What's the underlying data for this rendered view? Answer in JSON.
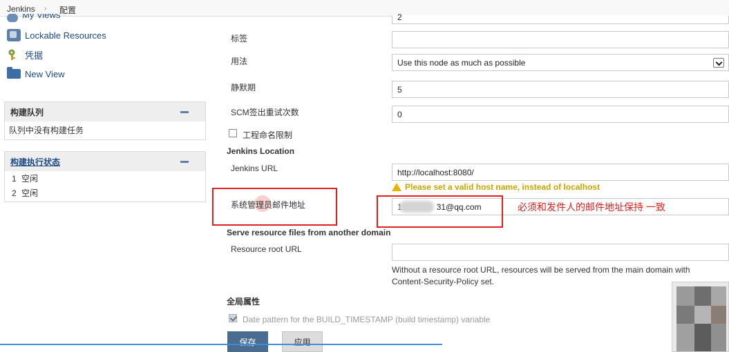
{
  "breadcrumb": {
    "items": [
      "Jenkins",
      "配置"
    ],
    "separator": "›"
  },
  "sidebar": {
    "links": [
      {
        "label": "My Views",
        "icon": "my-views-icon"
      },
      {
        "label": "Lockable Resources",
        "icon": "lock-icon"
      },
      {
        "label": "凭据",
        "icon": "key-icon"
      },
      {
        "label": "New View",
        "icon": "folder-icon"
      }
    ],
    "queue": {
      "title": "构建队列",
      "empty_text": "队列中没有构建任务"
    },
    "executors": {
      "title": "构建执行状态",
      "rows": [
        {
          "num": "1",
          "status": "空闲"
        },
        {
          "num": "2",
          "status": "空闲"
        }
      ]
    }
  },
  "form": {
    "executors_value": "2",
    "labels_label": "标签",
    "labels_value": "",
    "usage_label": "用法",
    "usage_value": "Use this node as much as possible",
    "quiet_label": "静默期",
    "quiet_value": "5",
    "scm_label": "SCM签出重试次数",
    "scm_value": "0",
    "restrict_label": "工程命名限制",
    "restrict_checked": false,
    "location_section": "Jenkins Location",
    "url_label": "Jenkins URL",
    "url_value": "http://localhost:8080/",
    "url_warning": "Please set a valid host name, instead of localhost",
    "admin_email_label": "系统管理员邮件地址",
    "admin_email_prefix": "1",
    "admin_email_suffix": "31@qq.com",
    "serve_section": "Serve resource files from another domain",
    "resource_root_label": "Resource root URL",
    "resource_root_value": "",
    "resource_root_help": "Without a resource root URL, resources will be served from the main domain with Content-Security-Policy set.",
    "global_props_section": "全局属性",
    "timestamp_label": "Date pattern for the BUILD_TIMESTAMP (build timestamp) variable",
    "timestamp_checked": true
  },
  "annotation": {
    "text": "必须和发件人的邮件地址保持 一致",
    "color": "#e01e1e"
  },
  "buttons": {
    "save": "保存",
    "apply": "应用"
  },
  "colors": {
    "accent": "#4b6c91",
    "link": "#204a87",
    "warning": "#c9a500"
  }
}
